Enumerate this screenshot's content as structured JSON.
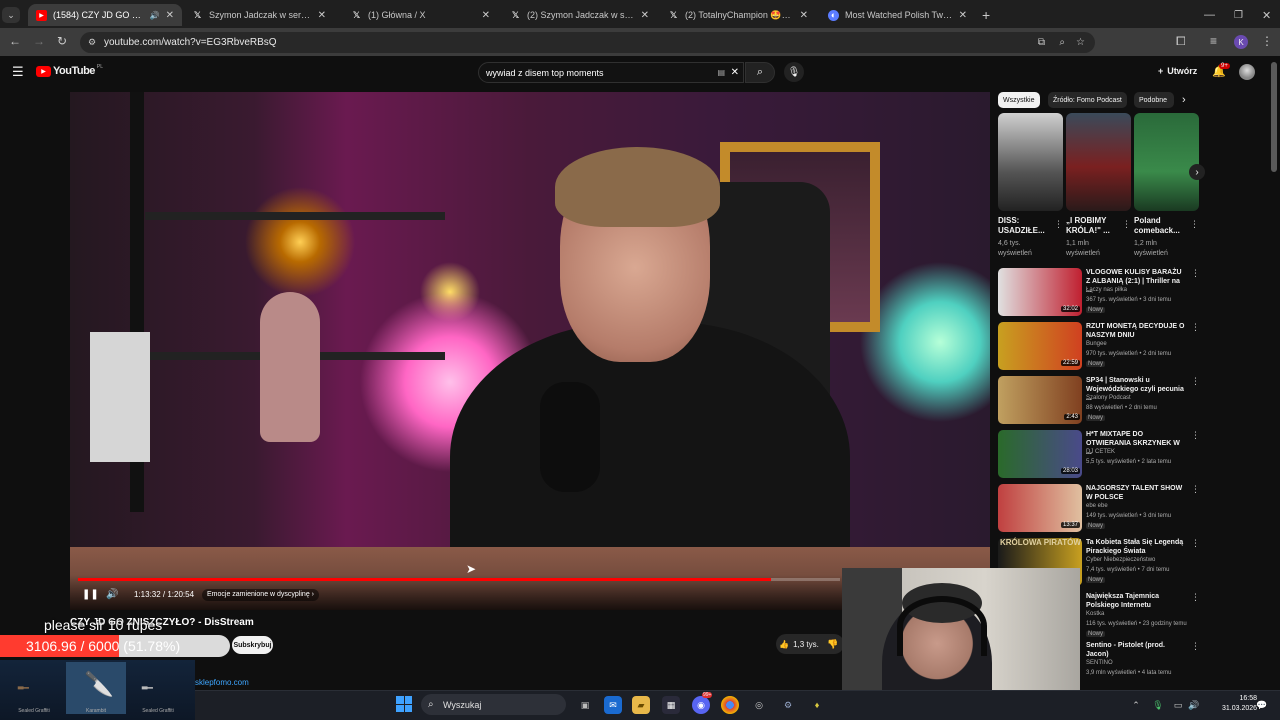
{
  "browser": {
    "tabs": [
      {
        "title": "(1584) CZY JD GO ZNISZCZY",
        "favicon": "youtube-icon",
        "active": true
      },
      {
        "title": "Szymon Jadczak w serwisie X: ",
        "favicon": "x-icon",
        "active": false
      },
      {
        "title": "(1) Główna / X",
        "favicon": "x-icon",
        "active": false
      },
      {
        "title": "(2) Szymon Jadczak w serwisie X",
        "favicon": "x-icon",
        "active": false
      },
      {
        "title": "(2) TotalnyChampion 🤩🫡 w X",
        "favicon": "x-icon",
        "active": false
      },
      {
        "title": "Most Watched Polish Twitch Streamers",
        "favicon": "chart-icon",
        "active": false
      }
    ],
    "new_tab": "+",
    "url": "youtube.com/watch?v=EG3RbveRBsQ",
    "profile_initial": "K"
  },
  "youtube": {
    "logo": "YouTube",
    "logo_region": "PL",
    "search_query": "wywiad z disem top moments",
    "create_label": "Utwórz",
    "notif_badge": "9+"
  },
  "player": {
    "time": "1:13:32 / 1:20:54",
    "progress": 0.909,
    "chapter": "Emocje zamienione w dyscyplinę",
    "title": "CZY JD GO ZNISZCZYŁO? - DisStream",
    "likes": "1,3 tys.",
    "link": "sklepfomo.com"
  },
  "sidebar": {
    "chips": [
      "Wszystkie",
      "Źródło: Fomo Podcast",
      "Podobne"
    ],
    "shorts": [
      {
        "title": "DISS: USADZIŁE...",
        "views": "4,6 tys. wyświetleń"
      },
      {
        "title": "„I ROBIMY KRÓLA!\" ...",
        "views": "1,1 mln wyświetleń"
      },
      {
        "title": "Poland comeback...",
        "views": "1,2 mln wyświetleń"
      }
    ],
    "videos": [
      {
        "title": "VLOGOWE KULISY BARAŻU Z ALBANIĄ (2:1) | Thriller na ...",
        "channel": "Łączy nas piłka",
        "meta": "367 tys. wyświetleń • 3 dni temu",
        "badge": "Nowy",
        "duration": "32:02"
      },
      {
        "title": "RZUT MONETĄ DECYDUJE O NASZYM DNIU",
        "channel": "Bungee",
        "meta": "970 tys. wyświetleń • 2 dni temu",
        "badge": "Nowy",
        "duration": "22:59"
      },
      {
        "title": "SP34 | Stanowski u Wojewódzkiego czyli pecunia ...",
        "channel": "Szalony Podcast",
        "meta": "88 wyświetleń • 2 dni temu",
        "badge": "Nowy",
        "duration": "2:43"
      },
      {
        "title": "H*T MIXTAPE DO OTWIERANIA SKRZYNEK W ...",
        "channel": "DJ CETEK",
        "meta": "5,5 tys. wyświetleń • 2 lata temu",
        "badge": "",
        "duration": "28:03"
      },
      {
        "title": "NAJGORSZY TALENT SHOW W POLSCE",
        "channel": "ebe ebe",
        "meta": "149 tys. wyświetleń • 3 dni temu",
        "badge": "Nowy",
        "duration": "13:37"
      },
      {
        "title": "Ta Kobieta Stała Się Legendą Pirackiego Świata",
        "channel": "Cyber Niebezpieczeństwo",
        "meta": "7,4 tys. wyświetleń • 7 dni temu",
        "badge": "Nowy",
        "duration": ""
      },
      {
        "title": "Największa Tajemnica Polskiego Internetu",
        "channel": "Kostka",
        "meta": "116 tys. wyświetleń • 23 godziny temu",
        "badge": "Nowy",
        "duration": ""
      },
      {
        "title": "Sentino - Pistolet (prod. Jacon)",
        "channel": "SENTINO",
        "meta": "3,9 mln wyświetleń • 4 lata temu",
        "badge": "",
        "duration": ""
      }
    ],
    "thumb_text_1": "KRÓLOWA PIRATÓW"
  },
  "overlay": {
    "message": "please sir 10 rupes",
    "goal": "3106.96 / 6000 (51.78%)",
    "goal_progress": 0.5178,
    "subscribe": "Subskrybuj",
    "skin_names": [
      "Sealed Graffiti",
      "Karambit",
      "Sealed Graffiti"
    ]
  },
  "taskbar": {
    "search_label": "Wyszukaj",
    "time": "16:58",
    "date": "31.03.2026",
    "badge": "99+"
  },
  "colors": {
    "youtube_red": "#ff0000",
    "link_blue": "#3ea6ff",
    "goal_red": "#ff3b2f"
  }
}
